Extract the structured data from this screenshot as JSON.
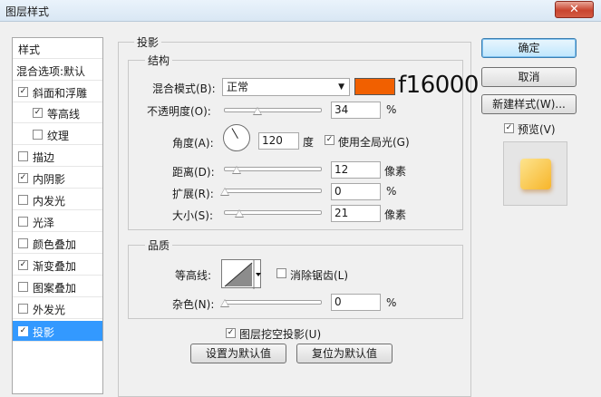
{
  "window": {
    "title": "图层样式",
    "close_glyph": "✕"
  },
  "style_list": {
    "header": "样式",
    "items": [
      {
        "label": "混合选项:默认",
        "checkbox": false,
        "checked": false
      },
      {
        "label": "斜面和浮雕",
        "checkbox": true,
        "checked": true
      },
      {
        "label": "等高线",
        "checkbox": true,
        "checked": true,
        "indent": true
      },
      {
        "label": "纹理",
        "checkbox": true,
        "checked": false,
        "indent": true
      },
      {
        "label": "描边",
        "checkbox": true,
        "checked": false
      },
      {
        "label": "内阴影",
        "checkbox": true,
        "checked": true
      },
      {
        "label": "内发光",
        "checkbox": true,
        "checked": false
      },
      {
        "label": "光泽",
        "checkbox": true,
        "checked": false
      },
      {
        "label": "颜色叠加",
        "checkbox": true,
        "checked": false
      },
      {
        "label": "渐变叠加",
        "checkbox": true,
        "checked": true
      },
      {
        "label": "图案叠加",
        "checkbox": true,
        "checked": false
      },
      {
        "label": "外发光",
        "checkbox": true,
        "checked": false
      },
      {
        "label": "投影",
        "checkbox": true,
        "checked": true,
        "selected": true
      }
    ]
  },
  "drop_shadow": {
    "title": "投影",
    "structure": {
      "title": "结构",
      "blend_mode_label": "混合模式(B):",
      "blend_mode_value": "正常",
      "shadow_color": "#f16000",
      "color_annotation": "f16000",
      "opacity_label": "不透明度(O):",
      "opacity_value": "34",
      "opacity_unit": "%",
      "angle_label": "角度(A):",
      "angle_value": "120",
      "angle_unit": "度",
      "global_light_label": "使用全局光(G)",
      "global_light_checked": true,
      "distance_label": "距离(D):",
      "distance_value": "12",
      "distance_unit": "像素",
      "spread_label": "扩展(R):",
      "spread_value": "0",
      "spread_unit": "%",
      "size_label": "大小(S):",
      "size_value": "21",
      "size_unit": "像素"
    },
    "quality": {
      "title": "品质",
      "contour_label": "等高线:",
      "anti_alias_label": "消除锯齿(L)",
      "anti_alias_checked": false,
      "noise_label": "杂色(N):",
      "noise_value": "0",
      "noise_unit": "%"
    },
    "knockout_label": "图层挖空投影(U)",
    "knockout_checked": true,
    "make_default_label": "设置为默认值",
    "reset_default_label": "复位为默认值"
  },
  "sidebar": {
    "ok_label": "确定",
    "cancel_label": "取消",
    "new_style_label": "新建样式(W)...",
    "preview_label": "预览(V)",
    "preview_checked": true
  },
  "colors": {
    "selection": "#3399ff",
    "shadow_color": "#f16000"
  }
}
